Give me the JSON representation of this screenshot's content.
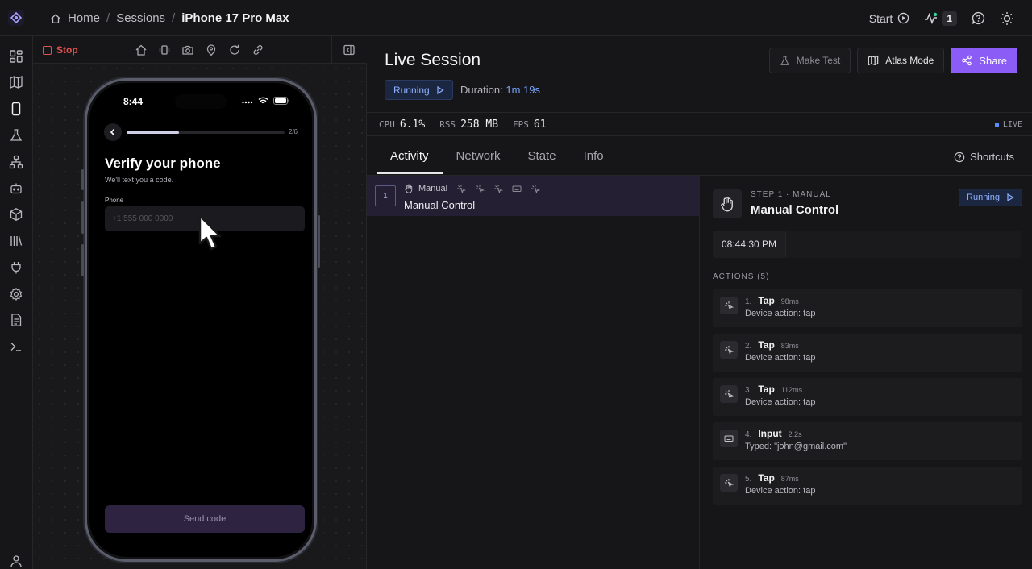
{
  "breadcrumb": {
    "home": "Home",
    "sessions": "Sessions",
    "current": "iPhone 17 Pro Max"
  },
  "topbar": {
    "start_label": "Start",
    "activity_count": "1"
  },
  "device_toolbar": {
    "stop_label": "Stop"
  },
  "phone": {
    "time": "8:44",
    "step_count": "2/6",
    "progress_fraction": 0.33,
    "title": "Verify your phone",
    "subtitle": "We'll text you a code.",
    "field_label": "Phone",
    "input_placeholder": "+1 555 000 0000",
    "send_label": "Send code"
  },
  "session": {
    "title": "Live Session",
    "status": "Running",
    "duration_label": "Duration:",
    "duration_value": "1m 19s",
    "make_test_label": "Make Test",
    "atlas_label": "Atlas Mode",
    "share_label": "Share"
  },
  "stats": {
    "cpu_label": "CPU",
    "cpu_value": "6.1%",
    "rss_label": "RSS",
    "rss_value": "258 MB",
    "fps_label": "FPS",
    "fps_value": "61",
    "live_label": "LIVE"
  },
  "tabs": [
    {
      "label": "Activity"
    },
    {
      "label": "Network"
    },
    {
      "label": "State"
    },
    {
      "label": "Info"
    }
  ],
  "shortcuts_label": "Shortcuts",
  "activity": {
    "number": "1",
    "type": "Manual",
    "title": "Manual Control"
  },
  "detail": {
    "step_label": "STEP 1 · MANUAL",
    "title": "Manual Control",
    "status": "Running",
    "timestamp": "08:44:30 PM",
    "actions_header": "ACTIONS (5)",
    "actions": [
      {
        "index": "1.",
        "name": "Tap",
        "duration": "98ms",
        "desc": "Device action: tap",
        "icon": "tap-icon"
      },
      {
        "index": "2.",
        "name": "Tap",
        "duration": "83ms",
        "desc": "Device action: tap",
        "icon": "tap-icon"
      },
      {
        "index": "3.",
        "name": "Tap",
        "duration": "112ms",
        "desc": "Device action: tap",
        "icon": "tap-icon"
      },
      {
        "index": "4.",
        "name": "Input",
        "duration": "2.2s",
        "desc": "Typed: \"john@gmail.com\"",
        "icon": "keyboard-icon"
      },
      {
        "index": "5.",
        "name": "Tap",
        "duration": "87ms",
        "desc": "Device action: tap",
        "icon": "tap-icon"
      }
    ]
  },
  "colors": {
    "accent": "#8b5cf6",
    "running": "#8fb0ff",
    "stop": "#e0524f",
    "duration": "#7aa4ff"
  }
}
